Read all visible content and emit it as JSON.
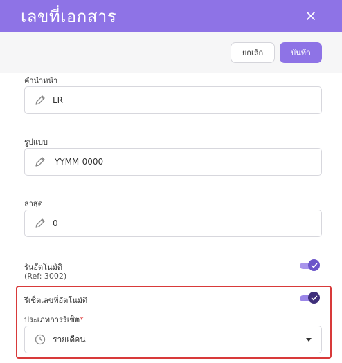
{
  "header": {
    "title": "เลขที่เอกสาร",
    "close_icon": "close-icon"
  },
  "toolbar": {
    "cancel_label": "ยกเลิก",
    "save_label": "บันทึก"
  },
  "form": {
    "prefix": {
      "label": "คำนำหน้า",
      "value": "LR",
      "icon": "pencil-icon"
    },
    "format": {
      "label": "รูปแบบ",
      "value": "-YYMM-0000",
      "icon": "pencil-icon"
    },
    "latest": {
      "label": "ล่าสุด",
      "value": "0",
      "icon": "pencil-icon"
    },
    "auto_run": {
      "label": "รันอัตโนมัติ",
      "ref": "(Ref: 3002)",
      "enabled": true
    },
    "auto_reset": {
      "label": "รีเซ็ตเลขที่อัตโนมัติ",
      "enabled": true
    },
    "reset_type": {
      "label": "ประเภทการรีเซ็ต",
      "required_mark": "*",
      "value": "รายเดือน",
      "icon": "clock-icon"
    }
  },
  "colors": {
    "accent": "#8e73e6",
    "toggle_on_track": "#9b86e8",
    "toggle_knob_light": "#6b55c9",
    "toggle_knob_dark": "#3f2f7a",
    "highlight": "#d83a3a"
  }
}
